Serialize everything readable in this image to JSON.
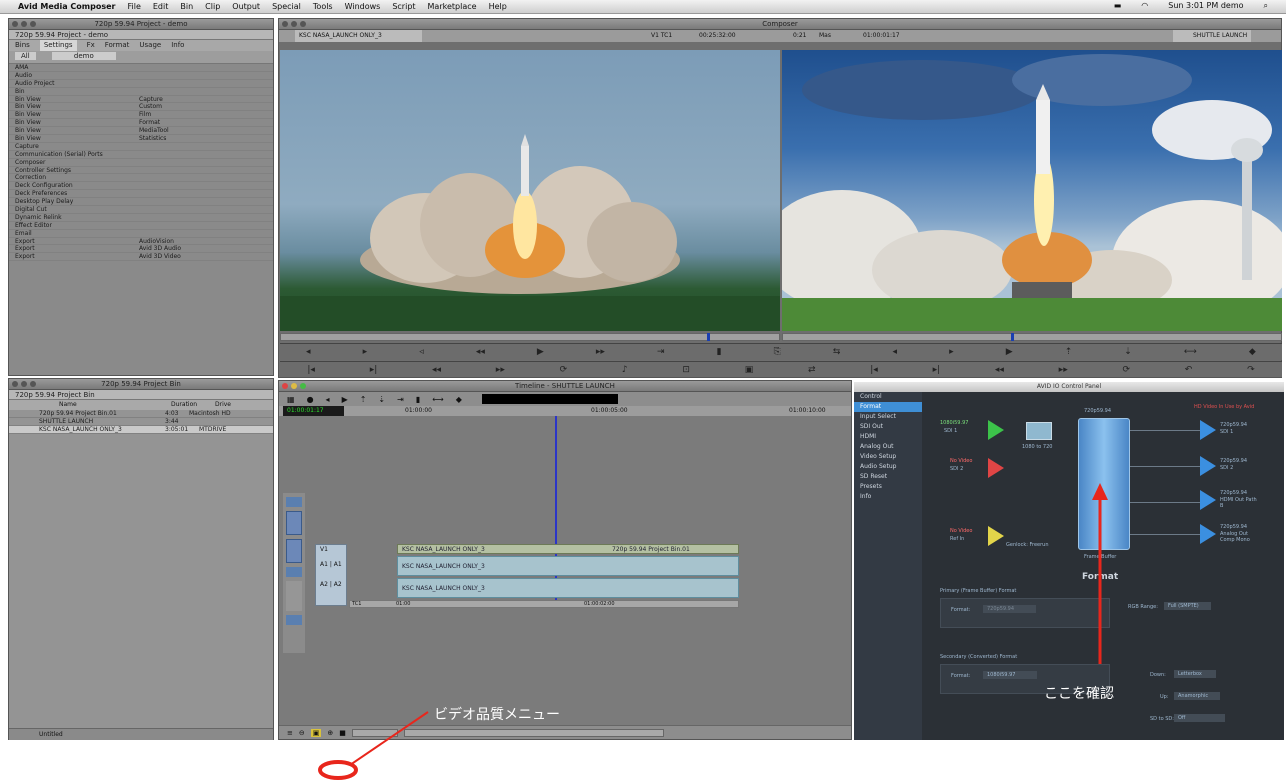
{
  "menubar": {
    "app_name": "Avid Media Composer",
    "items": [
      "File",
      "Edit",
      "Bin",
      "Clip",
      "Output",
      "Special",
      "Tools",
      "Windows",
      "Script",
      "Marketplace",
      "Help"
    ],
    "status": "Sun 3:01 PM  demo"
  },
  "project_panel": {
    "title": "720p 59.94 Project - demo",
    "project_name": "720p 59.94 Project - demo",
    "tabs": [
      "Bins",
      "Settings",
      "Fx",
      "Format",
      "Usage",
      "Info"
    ],
    "active_tab": "Settings",
    "filter": "All",
    "user": "demo",
    "settings": [
      [
        "AMA",
        ""
      ],
      [
        "Audio",
        ""
      ],
      [
        "Audio Project",
        ""
      ],
      [
        "Bin",
        ""
      ],
      [
        "Bin View",
        "Capture"
      ],
      [
        "Bin View",
        "Custom"
      ],
      [
        "Bin View",
        "Film"
      ],
      [
        "Bin View",
        "Format"
      ],
      [
        "Bin View",
        "MediaTool"
      ],
      [
        "Bin View",
        "Statistics"
      ],
      [
        "Capture",
        ""
      ],
      [
        "Communication (Serial) Ports",
        ""
      ],
      [
        "Composer",
        ""
      ],
      [
        "Controller Settings",
        ""
      ],
      [
        "Correction",
        ""
      ],
      [
        "Deck Configuration",
        ""
      ],
      [
        "Deck Preferences",
        ""
      ],
      [
        "Desktop Play Delay",
        ""
      ],
      [
        "Digital Cut",
        ""
      ],
      [
        "Dynamic Relink",
        ""
      ],
      [
        "Effect Editor",
        ""
      ],
      [
        "Email",
        ""
      ],
      [
        "Export",
        "AudioVision"
      ],
      [
        "Export",
        "Avid 3D Audio"
      ],
      [
        "Export",
        "Avid 3D Video"
      ]
    ]
  },
  "bin_panel": {
    "title": "720p 59.94 Project Bin",
    "tab": "720p 59.94 Project Bin",
    "columns": [
      "Name",
      "Duration",
      "Drive"
    ],
    "rows": [
      {
        "name": "720p 59.94 Project Bin.01",
        "duration": "4:03",
        "drive": "Macintosh HD"
      },
      {
        "name": "SHUTTLE LAUNCH",
        "duration": "3:44",
        "": ""
      },
      {
        "name": "KSC NASA_LAUNCH ONLY_3",
        "duration": "3:05:01",
        "drive": "MTDRIVE"
      }
    ],
    "footer": "Untitled"
  },
  "composer": {
    "title": "Composer",
    "left_clip": "KSC NASA_LAUNCH ONLY_3",
    "source_track": "V1 TC1",
    "source_tc": "00:25:32:00",
    "duration_label": "0:21",
    "mas_label": "Mas",
    "record_tc": "01:00:01:17",
    "right_clip": "SHUTTLE LAUNCH"
  },
  "timeline": {
    "title": "Timeline - SHUTTLE LAUNCH",
    "tc_start": "01:00:01:17",
    "tc_marker1": "01:00:00",
    "tc_marker2": "01:00:05:00",
    "tc_marker3": "01:00:10:00",
    "tracks": [
      {
        "label": "V1",
        "clip": "KSC NASA_LAUNCH ONLY_3",
        "extra": "720p 59.94 Project Bin.01"
      },
      {
        "label": "A1 | A1",
        "clip": "KSC NASA_LAUNCH ONLY_3",
        "extra": ""
      },
      {
        "label": "A2 | A2",
        "clip": "KSC NASA_LAUNCH ONLY_3",
        "extra": ""
      }
    ],
    "tc_row": "TC1",
    "tc_row_start": "01:00",
    "tc_row_end": "01:00:02:00",
    "zoom_label": "video quality"
  },
  "io_panel": {
    "title": "AVID IO Control Panel",
    "nav": [
      "Control",
      "Format",
      "Input Select",
      "SDI Out",
      "HDMI",
      "Analog Out",
      "Video Setup",
      "Audio Setup",
      "SD Reset",
      "Presets",
      "Info"
    ],
    "selected_nav": "Format",
    "warning": "HD Video In Use by Avid",
    "inputs": [
      {
        "label": "1080i59.97",
        "sub": "SDI 1",
        "color": "#3cc24a"
      },
      {
        "label": "No Video",
        "sub": "SDI 2",
        "color": "#e04545"
      },
      {
        "label": "No Video",
        "sub": "Ref In",
        "color": "#e3d54a"
      }
    ],
    "converter_label": "1080 to 720",
    "frame_buffer_top": "720p59.94",
    "frame_buffer_label": "Frame Buffer",
    "format_heading": "Format",
    "genlock": "Genlock: Freerun",
    "outputs": [
      {
        "label": "720p59.94",
        "sub": "SDI 1"
      },
      {
        "label": "720p59.94",
        "sub": "SDI 2"
      },
      {
        "label": "720p59.94",
        "sub": "HDMI Out Path B"
      },
      {
        "label": "720p59.94",
        "sub": "Analog Out Comp Mono"
      }
    ],
    "primary_heading": "Primary (Frame Buffer) Format",
    "primary_format_label": "Format:",
    "primary_format_value": "720p59.94",
    "rgb_range_label": "RGB Range:",
    "rgb_range_value": "Full (SMPTE)",
    "secondary_heading": "Secondary (Converted) Format",
    "secondary_format_label": "Format:",
    "secondary_format_value": "1080i59.97",
    "down_label": "Down:",
    "down_value": "Letterbox",
    "up_label": "Up:",
    "up_value": "Anamorphic",
    "sd_label": "SD to SD:",
    "sd_value": "Off"
  },
  "annotations": {
    "check_here": "ここを確認",
    "video_quality_menu": "ビデオ品質メニュー",
    "arrow_color": "#e8261c"
  }
}
